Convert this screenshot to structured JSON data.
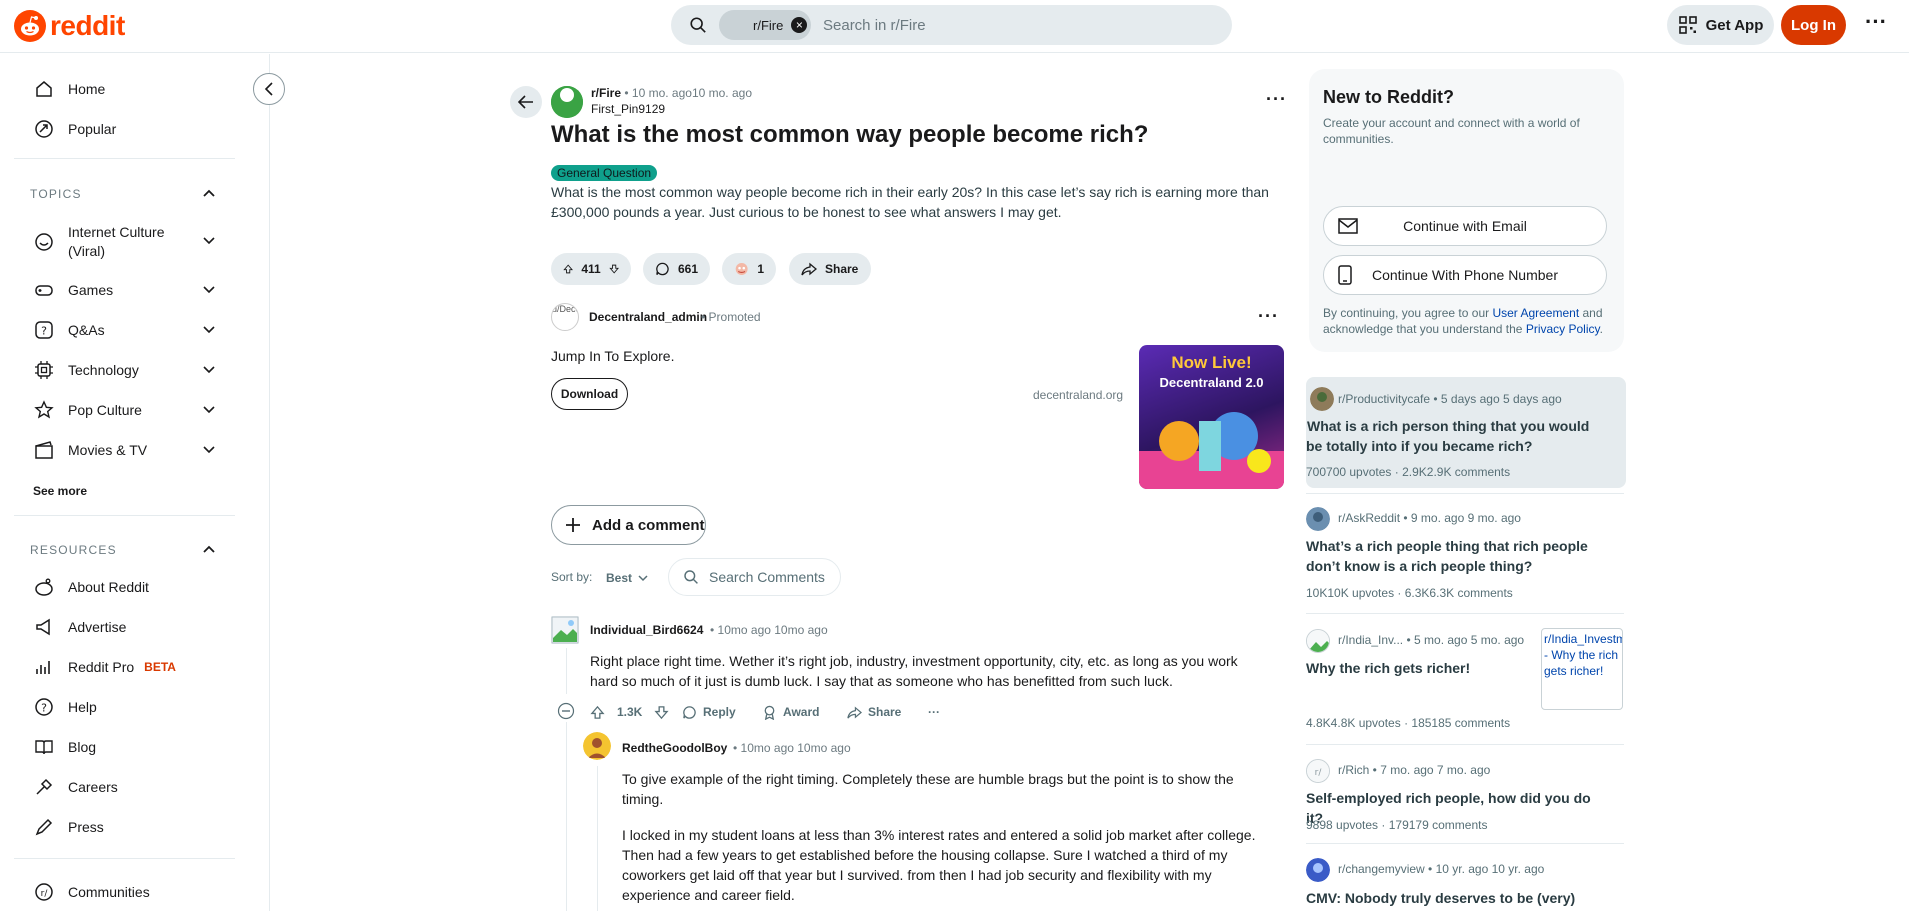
{
  "header": {
    "logo_text": "reddit",
    "search_chip": "r/Fire",
    "search_placeholder": "Search in r/Fire",
    "get_app_label": "Get App",
    "login_label": "Log In",
    "more_label": "···"
  },
  "sidebar": {
    "primary": [
      {
        "label": "Home",
        "icon": "home-icon"
      },
      {
        "label": "Popular",
        "icon": "popular-icon"
      }
    ],
    "topics_heading": "TOPICS",
    "topics": [
      {
        "label": "Internet Culture (Viral)",
        "icon": "internet-culture-icon"
      },
      {
        "label": "Games",
        "icon": "games-icon"
      },
      {
        "label": "Q&As",
        "icon": "qa-icon"
      },
      {
        "label": "Technology",
        "icon": "technology-icon"
      },
      {
        "label": "Pop Culture",
        "icon": "pop-culture-icon"
      },
      {
        "label": "Movies & TV",
        "icon": "movies-icon"
      }
    ],
    "see_more": "See more",
    "resources_heading": "RESOURCES",
    "resources": [
      {
        "label": "About Reddit",
        "icon": "about-icon"
      },
      {
        "label": "Advertise",
        "icon": "advertise-icon"
      },
      {
        "label": "Reddit Pro",
        "icon": "reddit-pro-icon",
        "badge": "BETA"
      },
      {
        "label": "Help",
        "icon": "help-icon"
      },
      {
        "label": "Blog",
        "icon": "blog-icon"
      },
      {
        "label": "Careers",
        "icon": "careers-icon"
      },
      {
        "label": "Press",
        "icon": "press-icon"
      }
    ],
    "communities": {
      "label": "Communities",
      "icon": "communities-icon"
    }
  },
  "post": {
    "subreddit": "r/Fire",
    "time": "10 mo. ago10 mo. ago",
    "author": "First_Pin9129",
    "title": "What is the most common way people become rich?",
    "flair": "General Question",
    "body": "What is the most common way people become rich in their early 20s? In this case let’s say rich is earning more than £300,000 pounds a year. Just curious to be honest to see what answers I may get.",
    "votes": "411",
    "comments": "661",
    "awards": "1",
    "share_label": "Share"
  },
  "promo": {
    "avatar_alt": "u/Dece",
    "name": "Decentraland_admin",
    "tag": "Promoted",
    "text": "Jump In To Explore.",
    "button": "Download",
    "domain": "decentraland.org",
    "thumb_line1": "Now Live!",
    "thumb_line2": "Decentraland 2.0"
  },
  "comments_bar": {
    "add_comment": "Add a comment",
    "sort_label": "Sort by:",
    "sort_value": "Best",
    "search_placeholder": "Search Comments"
  },
  "comments": [
    {
      "author": "Individual_Bird6624",
      "time": "10mo ago 10mo ago",
      "text": "Right place right time. Wether it’s right job, industry, investment opportunity, city, etc. as long as you work hard so much of it just is dumb luck. I say that as someone who has benefitted from such luck.",
      "votes": "1.3K",
      "reply": "Reply",
      "award": "Award",
      "share": "Share",
      "more": "···"
    },
    {
      "author": "RedtheGoodolBoy",
      "time": "10mo ago 10mo ago",
      "text1": "To give example of the right timing. Completely these are humble brags but the point is to show the timing.",
      "text2": "I locked in my student loans at less than 3% interest rates and entered a solid job market after college. Then had a few years to get established before the housing collapse. Sure I watched a third of my coworkers get laid off that year but I survived. from then I had job security and flexibility with my experience and career field."
    }
  ],
  "signup": {
    "title": "New to Reddit?",
    "subtitle": "Create your account and connect with a world of communities.",
    "email_btn": "Continue with Email",
    "phone_btn": "Continue With Phone Number",
    "legal_prefix": "By continuing, you agree to our ",
    "legal_link1": "User Agreement",
    "legal_mid": " and acknowledge that you understand the ",
    "legal_link2": "Privacy Policy",
    "legal_suffix": "."
  },
  "related": [
    {
      "sub": "r/Productivitycafe",
      "time": "5 days ago 5 days ago",
      "title": "What is a rich person thing that you would be totally into if you became rich?",
      "upvotes": "700700 upvotes",
      "comments": "2.9K2.9K comments"
    },
    {
      "sub": "r/AskReddit",
      "time": "9 mo. ago 9 mo. ago",
      "title": "What’s a rich people thing that rich people don’t know is a rich people thing?",
      "upvotes": "10K10K upvotes",
      "comments": "6.3K6.3K comments"
    },
    {
      "sub": "r/India_Inv...",
      "time": "5 mo. ago 5 mo. ago",
      "title": "Why the rich gets richer!",
      "upvotes": "4.8K4.8K upvotes",
      "comments": "185185 comments",
      "thumb_alt": "r/India_Investments - Why the rich gets richer!"
    },
    {
      "sub": "r/Rich",
      "time": "7 mo. ago 7 mo. ago",
      "title": "Self-employed rich people, how did you do it?",
      "upvotes": "9898 upvotes",
      "comments": "179179 comments"
    },
    {
      "sub": "r/changemyview",
      "time": "10 yr. ago 10 yr. ago",
      "title": "CMV: Nobody truly deserves to be (very) rich.",
      "upvotes": "",
      "comments": ""
    }
  ],
  "colors": {
    "brand": "#ff4500",
    "login": "#d93900",
    "flair": "#0fa08c",
    "link": "#0045ac"
  }
}
